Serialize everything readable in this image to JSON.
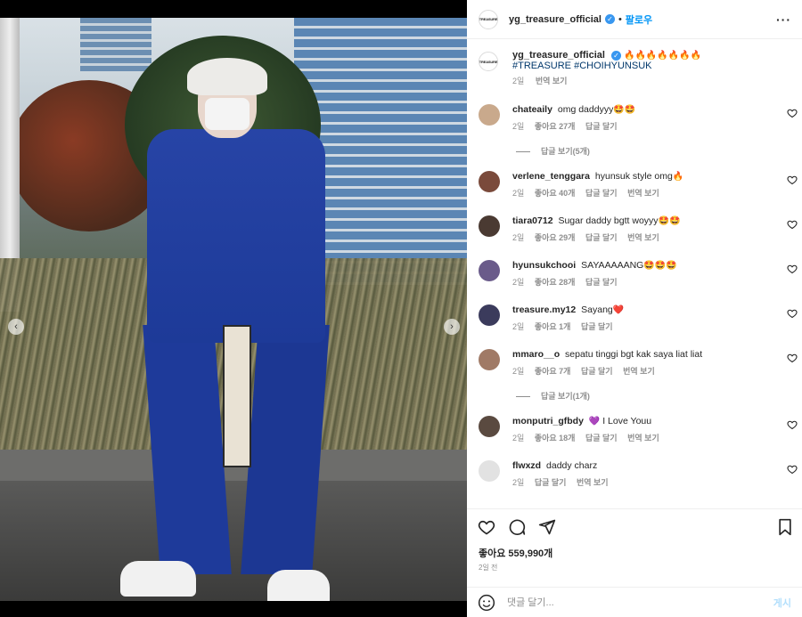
{
  "account": {
    "username": "yg_treasure_official",
    "logo_text": "TREASURE",
    "follow_label": "팔로우",
    "separator": "•"
  },
  "caption": {
    "emojis": "🔥🔥🔥🔥🔥🔥🔥",
    "hashtags": "#TREASURE #CHOIHYUNSUK",
    "age": "2일",
    "translate": "번역 보기"
  },
  "comments": [
    {
      "user": "chateaily",
      "text": "omg daddyyy",
      "emoji": "🤩🤩",
      "age": "2일",
      "likes": "좋아요 27개",
      "reply": "답글 달기",
      "translate": "",
      "avatar_color": "#c9a98c"
    },
    {
      "user": "verlene_tenggara",
      "text": "hyunsuk style omg",
      "emoji": "🔥",
      "age": "2일",
      "likes": "좋아요 40개",
      "reply": "답글 달기",
      "translate": "번역 보기",
      "avatar_color": "#7a4a3b"
    },
    {
      "user": "tiara0712",
      "text": "Sugar daddy bgtt woyyy",
      "emoji": "🤩🤩",
      "age": "2일",
      "likes": "좋아요 29개",
      "reply": "답글 달기",
      "translate": "번역 보기",
      "avatar_color": "#4a3a32"
    },
    {
      "user": "hyunsukchooi",
      "text": "SAYAAAAANG",
      "emoji": "🤩🤩🤩",
      "age": "2일",
      "likes": "좋아요 28개",
      "reply": "답글 달기",
      "translate": "",
      "avatar_color": "#6a5b8a"
    },
    {
      "user": "treasure.my12",
      "text": "Sayang",
      "emoji": "❤️",
      "age": "2일",
      "likes": "좋아요 1개",
      "reply": "답글 달기",
      "translate": "",
      "avatar_color": "#3b3b5c"
    },
    {
      "user": "mmaro__o",
      "text": "sepatu tinggi bgt kak saya liat liat",
      "emoji": "",
      "age": "2일",
      "likes": "좋아요 7개",
      "reply": "답글 달기",
      "translate": "번역 보기",
      "avatar_color": "#a07a66"
    },
    {
      "user": "monputri_gfbdy",
      "text": "I Love Youu",
      "emoji": "💜",
      "emoji_prefix": "💜",
      "age": "2일",
      "likes": "좋아요 18개",
      "reply": "답글 달기",
      "translate": "번역 보기",
      "avatar_color": "#5a4a40"
    },
    {
      "user": "flwxzd",
      "text": "daddy charz",
      "emoji": "",
      "age": "2일",
      "likes": "",
      "reply": "답글 달기",
      "translate": "번역 보기",
      "avatar_color": "#e2e2e2"
    }
  ],
  "replies": [
    {
      "label": "답글 보기(5개)"
    },
    {
      "label": "답글 보기(1개)"
    }
  ],
  "footer": {
    "likes": "좋아요 559,990개",
    "time": "2일 전",
    "comment_placeholder": "댓글 달기...",
    "post_label": "게시"
  },
  "carousel": {
    "slides": 5,
    "active_index": 2
  },
  "colors": {
    "accent": "#0095f6",
    "muted": "#8e8e8e",
    "hashtag": "#00376b"
  }
}
